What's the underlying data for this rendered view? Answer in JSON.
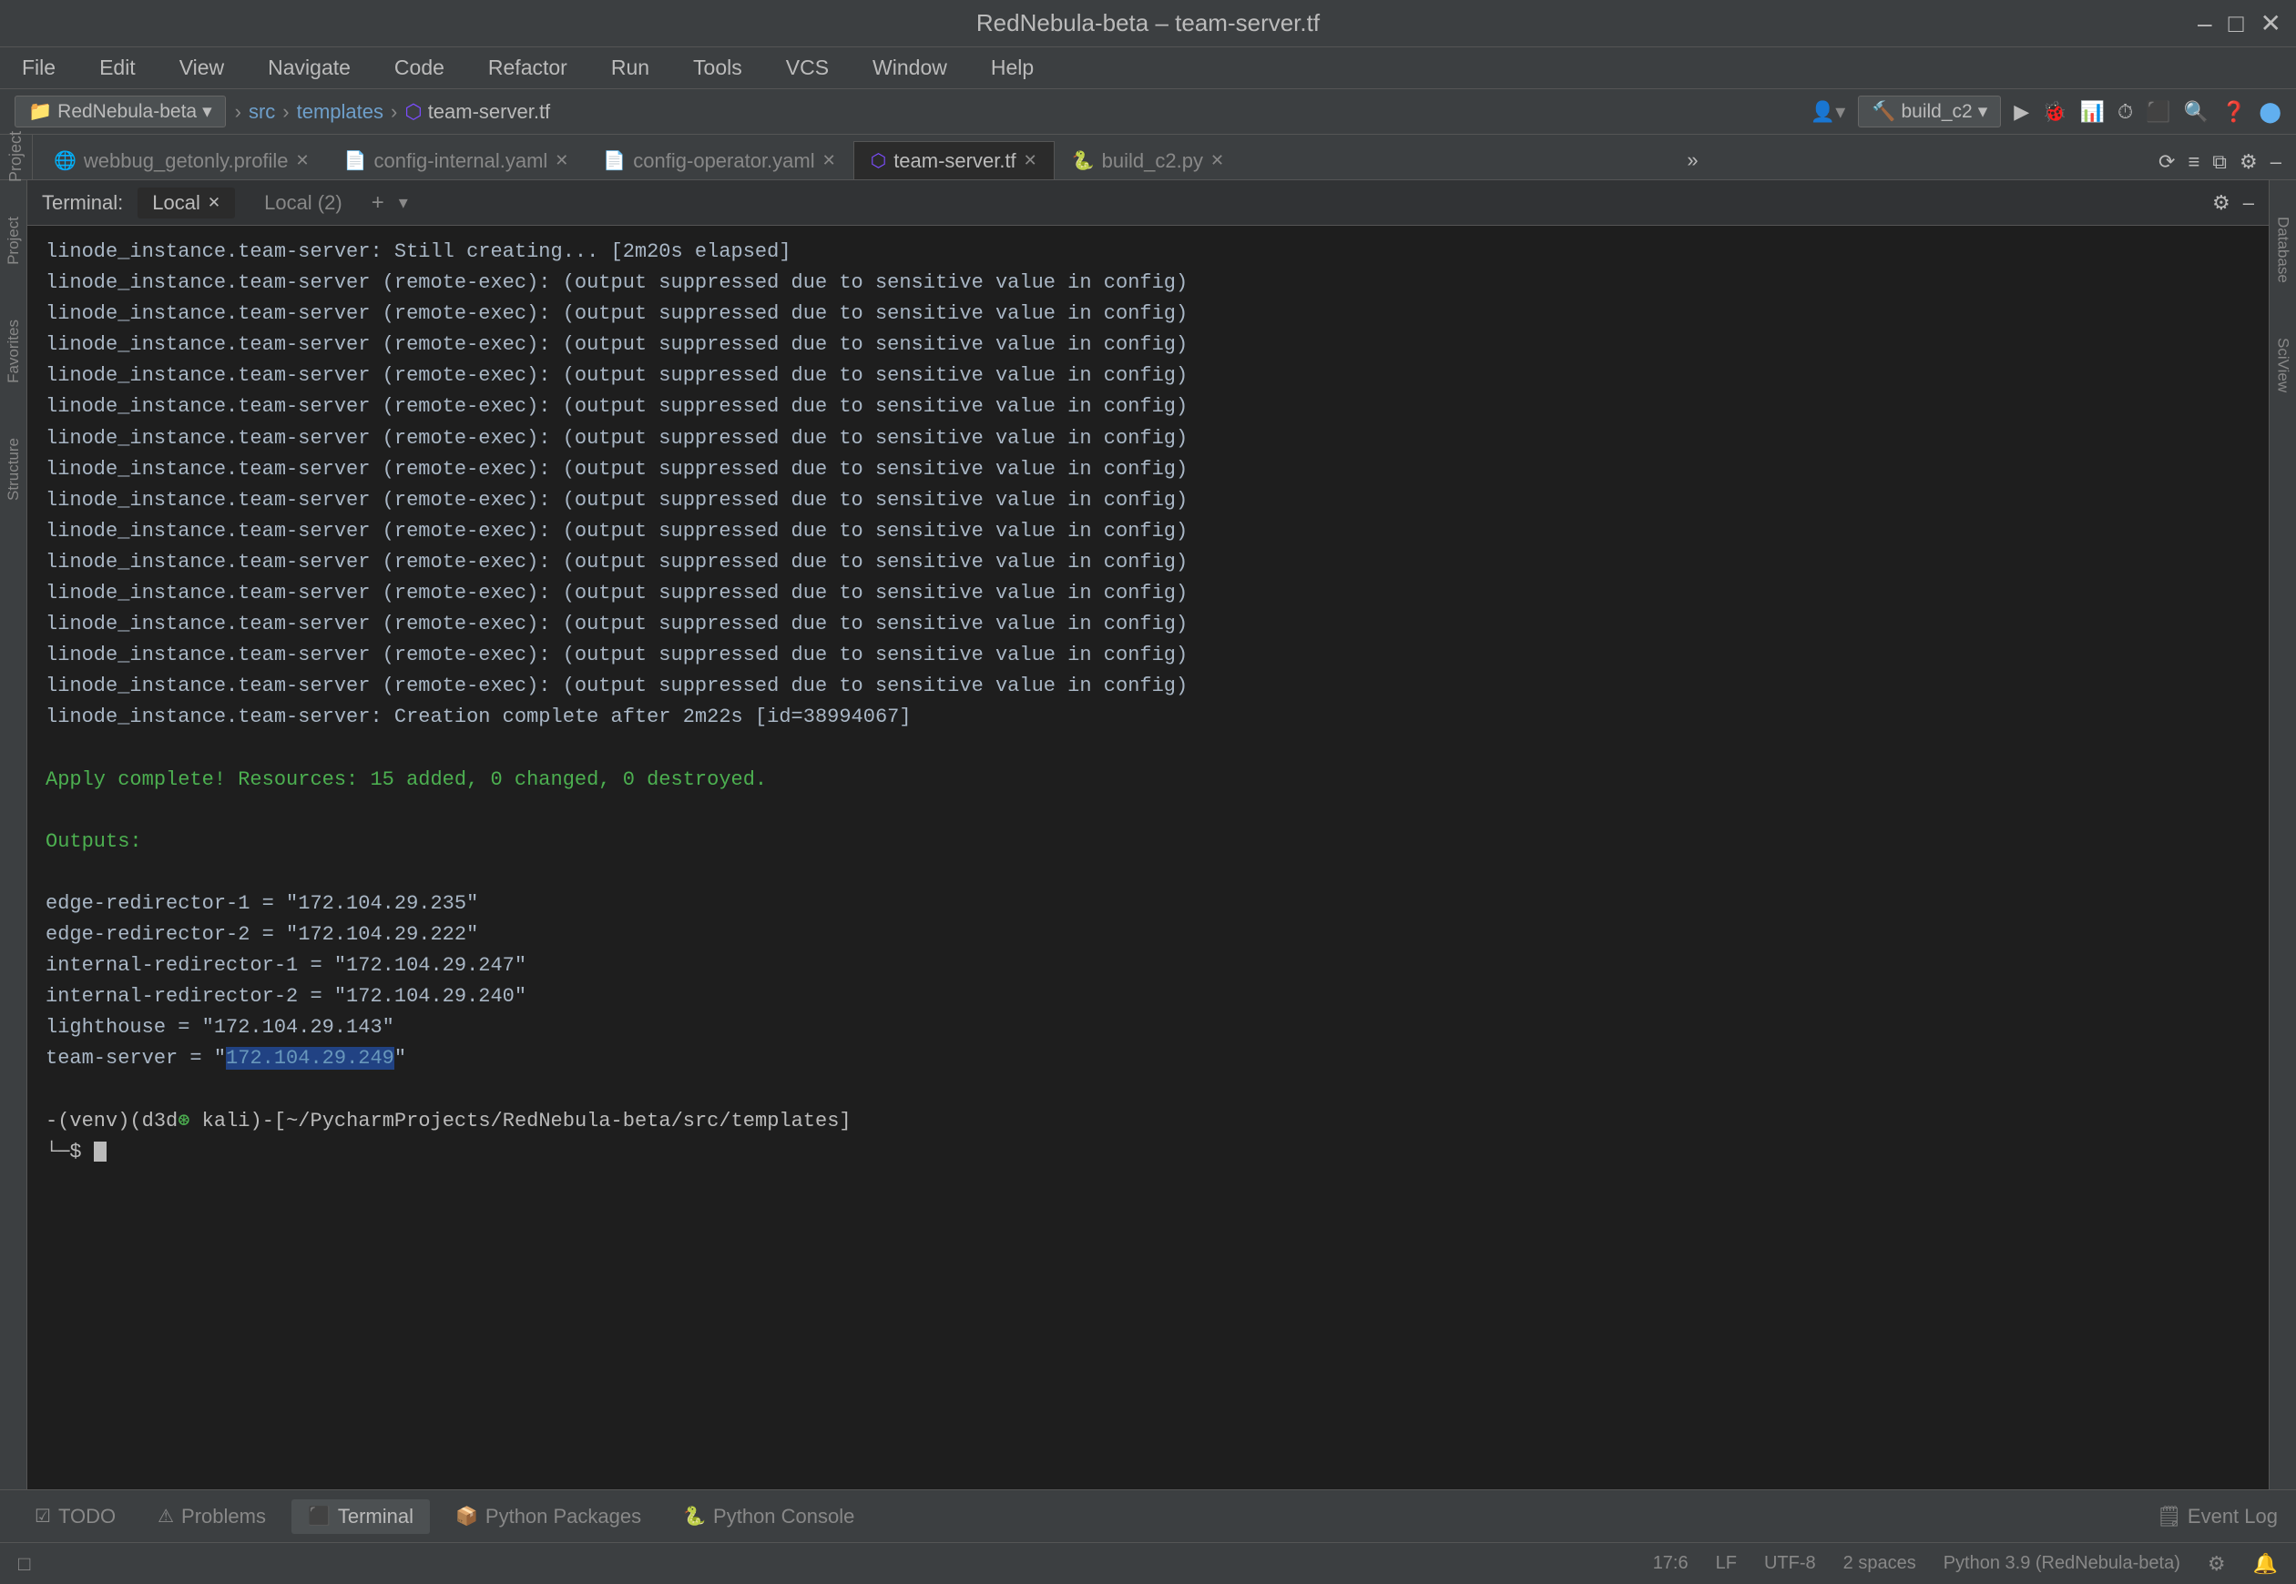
{
  "window": {
    "title": "RedNebula-beta – team-server.tf",
    "controls": [
      "–",
      "□",
      "✕"
    ]
  },
  "menubar": {
    "items": [
      "File",
      "Edit",
      "View",
      "Navigate",
      "Code",
      "Refactor",
      "Run",
      "Tools",
      "VCS",
      "Window",
      "Help"
    ]
  },
  "toolbar": {
    "breadcrumbs": [
      "RedNebula-beta",
      "src",
      "templates",
      "team-server.tf"
    ],
    "build_config": "build_c2",
    "run_label": "▶",
    "buttons": [
      "⚙",
      "🔍",
      "❓"
    ]
  },
  "editor_tabs": {
    "tabs": [
      {
        "icon": "🌐",
        "label": "webbug_getonly.profile",
        "active": false,
        "closable": true
      },
      {
        "icon": "📄",
        "label": "config-internal.yaml",
        "active": false,
        "closable": true
      },
      {
        "icon": "📄",
        "label": "config-operator.yaml",
        "active": false,
        "closable": true
      },
      {
        "icon": "⬡",
        "label": "team-server.tf",
        "active": true,
        "closable": true
      },
      {
        "icon": "🐍",
        "label": "build_c2.py",
        "active": false,
        "closable": true
      }
    ],
    "overflow": "»"
  },
  "terminal": {
    "label": "Terminal:",
    "tabs": [
      {
        "label": "Local",
        "active": true,
        "closable": true
      },
      {
        "label": "Local (2)",
        "active": false
      }
    ],
    "add_tab": "+",
    "dropdown": "▾"
  },
  "terminal_output": {
    "lines": [
      {
        "text": "linode_instance.team-server: Still creating... [2m20s elapsed]",
        "type": "normal"
      },
      {
        "text": "linode_instance.team-server (remote-exec): (output suppressed due to sensitive value in config)",
        "type": "normal"
      },
      {
        "text": "linode_instance.team-server (remote-exec): (output suppressed due to sensitive value in config)",
        "type": "normal"
      },
      {
        "text": "linode_instance.team-server (remote-exec): (output suppressed due to sensitive value in config)",
        "type": "normal"
      },
      {
        "text": "linode_instance.team-server (remote-exec): (output suppressed due to sensitive value in config)",
        "type": "normal"
      },
      {
        "text": "linode_instance.team-server (remote-exec): (output suppressed due to sensitive value in config)",
        "type": "normal"
      },
      {
        "text": "linode_instance.team-server (remote-exec): (output suppressed due to sensitive value in config)",
        "type": "normal"
      },
      {
        "text": "linode_instance.team-server (remote-exec): (output suppressed due to sensitive value in config)",
        "type": "normal"
      },
      {
        "text": "linode_instance.team-server (remote-exec): (output suppressed due to sensitive value in config)",
        "type": "normal"
      },
      {
        "text": "linode_instance.team-server (remote-exec): (output suppressed due to sensitive value in config)",
        "type": "normal"
      },
      {
        "text": "linode_instance.team-server (remote-exec): (output suppressed due to sensitive value in config)",
        "type": "normal"
      },
      {
        "text": "linode_instance.team-server (remote-exec): (output suppressed due to sensitive value in config)",
        "type": "normal"
      },
      {
        "text": "linode_instance.team-server (remote-exec): (output suppressed due to sensitive value in config)",
        "type": "normal"
      },
      {
        "text": "linode_instance.team-server (remote-exec): (output suppressed due to sensitive value in config)",
        "type": "normal"
      },
      {
        "text": "linode_instance.team-server (remote-exec): (output suppressed due to sensitive value in config)",
        "type": "normal"
      },
      {
        "text": "linode_instance.team-server: Creation complete after 2m22s [id=38994067]",
        "type": "normal"
      },
      {
        "text": "",
        "type": "blank"
      },
      {
        "text": "Apply complete! Resources: 15 added, 0 changed, 0 destroyed.",
        "type": "green"
      },
      {
        "text": "",
        "type": "blank"
      },
      {
        "text": "Outputs:",
        "type": "green"
      },
      {
        "text": "",
        "type": "blank"
      },
      {
        "text": "edge-redirector-1 = \"172.104.29.235\"",
        "type": "normal"
      },
      {
        "text": "edge-redirector-2 = \"172.104.29.222\"",
        "type": "normal"
      },
      {
        "text": "internal-redirector-1 = \"172.104.29.247\"",
        "type": "normal"
      },
      {
        "text": "internal-redirector-2 = \"172.104.29.240\"",
        "type": "normal"
      },
      {
        "text": "lighthouse = \"172.104.29.143\"",
        "type": "normal"
      },
      {
        "text_parts": [
          {
            "text": "team-server = \"",
            "type": "normal"
          },
          {
            "text": "172.104.29.249",
            "type": "highlight"
          },
          {
            "text": "\"",
            "type": "normal"
          }
        ],
        "type": "mixed"
      },
      {
        "text": "",
        "type": "blank"
      }
    ],
    "prompt_venv": "(venv)",
    "prompt_user": "d3d",
    "prompt_at": "⊛",
    "prompt_host": "kali",
    "prompt_dir": "~/PycharmProjects/RedNebula-beta/src/templates",
    "prompt_symbol": "└─$"
  },
  "bottom_tabs": {
    "tabs": [
      {
        "icon": "☑",
        "label": "TODO",
        "active": false
      },
      {
        "icon": "⚠",
        "label": "Problems",
        "active": false
      },
      {
        "icon": "⬛",
        "label": "Terminal",
        "active": true
      },
      {
        "icon": "📦",
        "label": "Python Packages",
        "active": false
      },
      {
        "icon": "🐍",
        "label": "Python Console",
        "active": false
      }
    ],
    "event_log": "🗒 Event Log"
  },
  "status_bar": {
    "left": [
      "□"
    ],
    "position": "17:6",
    "line_ending": "LF",
    "encoding": "UTF-8",
    "indent": "2 spaces",
    "interpreter": "Python 3.9 (RedNebula-beta)",
    "icons": [
      "⚙",
      "🔔"
    ]
  },
  "sidebar": {
    "left_labels": [
      "Project",
      "Favorites",
      "Structure"
    ],
    "right_labels": [
      "Database",
      "SciView"
    ]
  }
}
